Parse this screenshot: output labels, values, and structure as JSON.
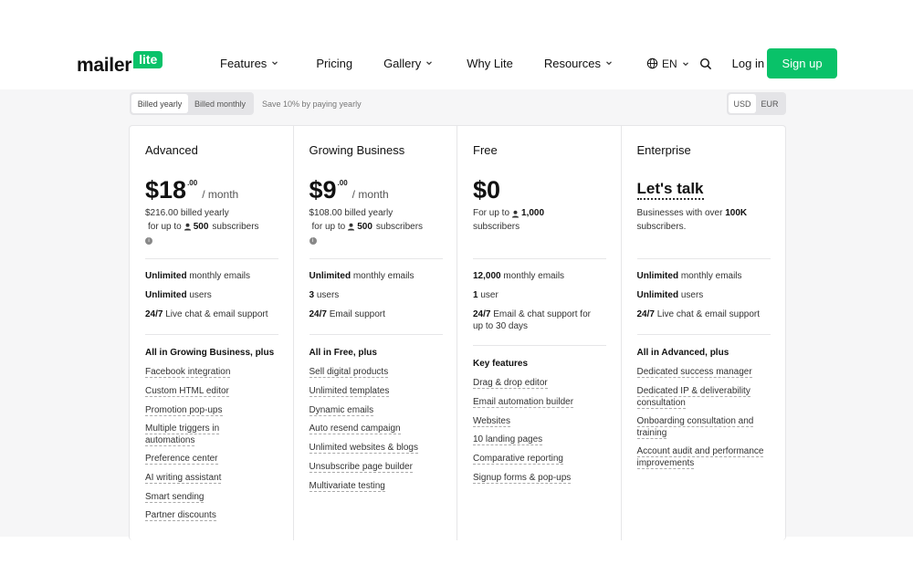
{
  "header": {
    "logo_word": "mailer",
    "logo_badge": "lite",
    "nav": [
      {
        "label": "Features",
        "dropdown": true
      },
      {
        "label": "Pricing",
        "dropdown": false
      },
      {
        "label": "Gallery",
        "dropdown": true
      },
      {
        "label": "Why Lite",
        "dropdown": false
      },
      {
        "label": "Resources",
        "dropdown": true
      }
    ],
    "language": "EN",
    "login_label": "Log in",
    "signup_label": "Sign up",
    "accent_color": "#09c269"
  },
  "billing": {
    "yearly_label": "Billed yearly",
    "monthly_label": "Billed monthly",
    "save_note": "Save 10% by paying yearly",
    "currency_usd": "USD",
    "currency_eur": "EUR"
  },
  "plans": [
    {
      "name": "Advanced",
      "price": "$18",
      "cents": ".00",
      "per": "/ month",
      "billed": "$216.00 billed yearly",
      "sub_prefix": "for up to",
      "sub_count": "500",
      "sub_suffix": "subscribers",
      "features": [
        {
          "bold": "Unlimited",
          "rest": " monthly emails"
        },
        {
          "bold": "Unlimited",
          "rest": " users"
        },
        {
          "bold": "24/7",
          "rest": " Live chat & email support"
        }
      ],
      "section_title": "All in Growing Business, plus",
      "items": [
        "Facebook integration",
        "Custom HTML editor",
        "Promotion pop-ups",
        "Multiple triggers in automations",
        "Preference center",
        "AI writing assistant",
        "Smart sending",
        "Partner discounts"
      ]
    },
    {
      "name": "Growing Business",
      "price": "$9",
      "cents": ".00",
      "per": "/ month",
      "billed": "$108.00 billed yearly",
      "sub_prefix": "for up to",
      "sub_count": "500",
      "sub_suffix": "subscribers",
      "features": [
        {
          "bold": "Unlimited",
          "rest": " monthly emails"
        },
        {
          "bold": "3",
          "rest": " users"
        },
        {
          "bold": "24/7",
          "rest": " Email support"
        }
      ],
      "section_title": "All in Free, plus",
      "items": [
        "Sell digital products",
        "Unlimited templates",
        "Dynamic emails",
        "Auto resend campaign",
        "Unlimited websites & blogs",
        "Unsubscribe page builder",
        "Multivariate testing"
      ]
    },
    {
      "name": "Free",
      "price": "$0",
      "sub_prefix": "For up to",
      "sub_count": "1,000",
      "sub_suffix": "subscribers",
      "features": [
        {
          "bold": "12,000",
          "rest": " monthly emails"
        },
        {
          "bold": "1",
          "rest": " user"
        },
        {
          "bold": "24/7",
          "rest": " Email & chat support for up to 30 days"
        }
      ],
      "section_title": "Key features",
      "items": [
        "Drag & drop editor",
        "Email automation builder",
        "Websites",
        "10 landing pages",
        "Comparative reporting",
        "Signup forms & pop-ups"
      ]
    },
    {
      "name": "Enterprise",
      "price_text": "Let's talk",
      "note_prefix": "Businesses with over ",
      "note_bold": "100K",
      "note_suffix": " subscribers.",
      "features": [
        {
          "bold": "Unlimited",
          "rest": " monthly emails"
        },
        {
          "bold": "Unlimited",
          "rest": " users"
        },
        {
          "bold": "24/7",
          "rest": " Live chat & email support"
        }
      ],
      "section_title": "All in Advanced, plus",
      "items": [
        "Dedicated success manager",
        "Dedicated IP & deliverability consultation",
        "Onboarding consultation and training",
        "Account audit and performance improvements"
      ]
    }
  ]
}
